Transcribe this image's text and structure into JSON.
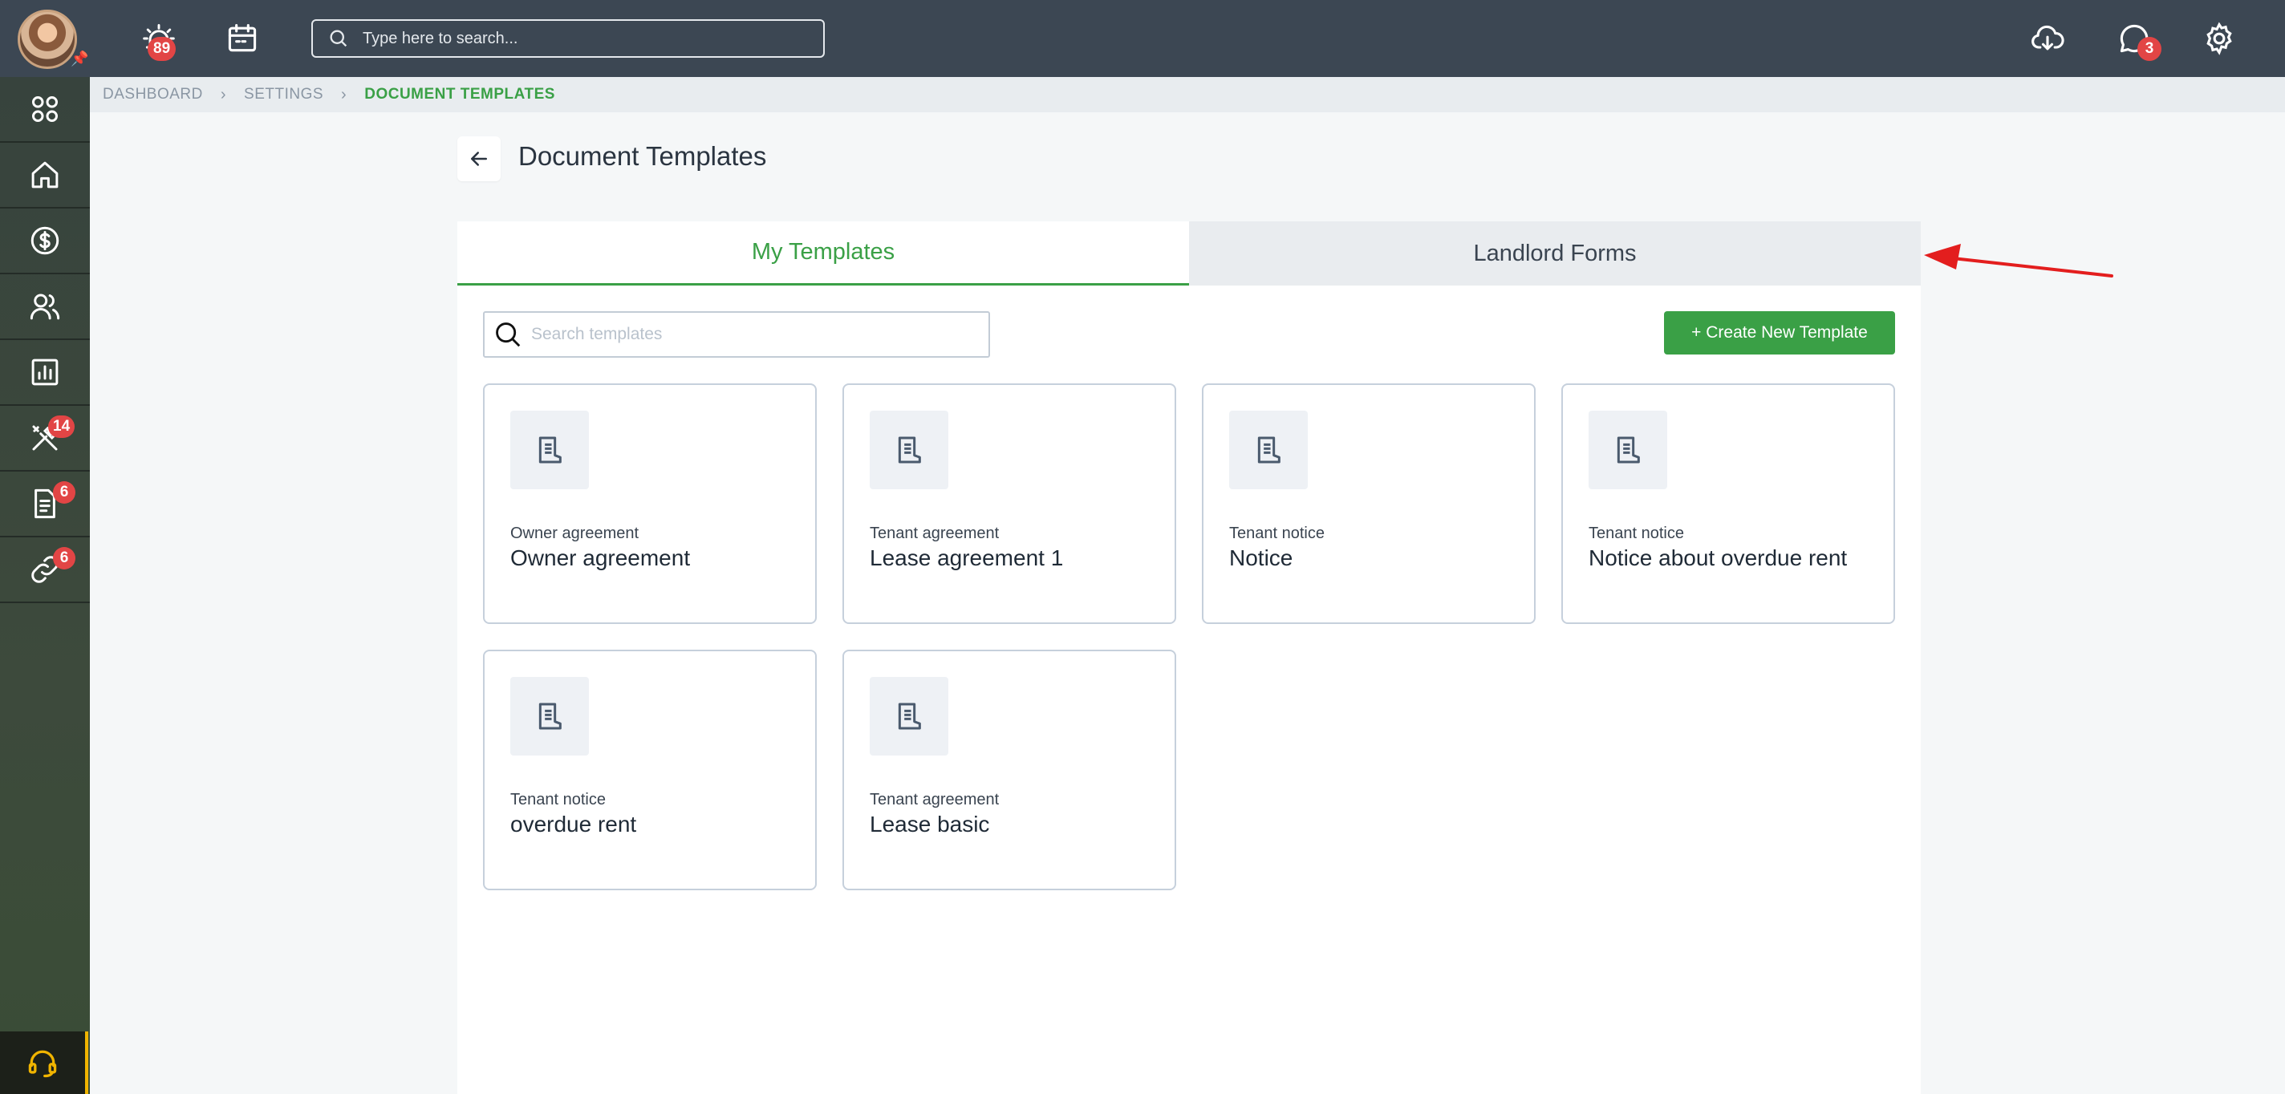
{
  "header": {
    "alerts_badge": "89",
    "search_placeholder": "Type here to search...",
    "messages_badge": "3"
  },
  "sidebar": {
    "items": [
      {
        "icon": "apps-grid-icon"
      },
      {
        "icon": "home-icon"
      },
      {
        "icon": "dollar-icon"
      },
      {
        "icon": "people-icon"
      },
      {
        "icon": "reports-icon"
      },
      {
        "icon": "tools-icon",
        "badge": "14"
      },
      {
        "icon": "document-icon",
        "badge": "6"
      },
      {
        "icon": "link-icon",
        "badge": "6"
      }
    ],
    "support_icon": "headset-icon"
  },
  "breadcrumb": [
    "DASHBOARD",
    "SETTINGS",
    "DOCUMENT TEMPLATES"
  ],
  "page": {
    "title": "Document Templates",
    "tabs": [
      "My Templates",
      "Landlord Forms"
    ],
    "search_placeholder": "Search templates",
    "create_button": "+ Create New Template"
  },
  "templates": [
    {
      "category": "Owner agreement",
      "name": "Owner agreement"
    },
    {
      "category": "Tenant agreement",
      "name": "Lease agreement 1"
    },
    {
      "category": "Tenant notice",
      "name": "Notice"
    },
    {
      "category": "Tenant notice",
      "name": "Notice about overdue rent"
    },
    {
      "category": "Tenant notice",
      "name": "overdue rent"
    },
    {
      "category": "Tenant agreement",
      "name": "Lease basic"
    }
  ],
  "colors": {
    "accent": "#3aa046",
    "topbar": "#3c4753",
    "badge": "#e24545",
    "annotation_arrow": "#e31e1e"
  }
}
